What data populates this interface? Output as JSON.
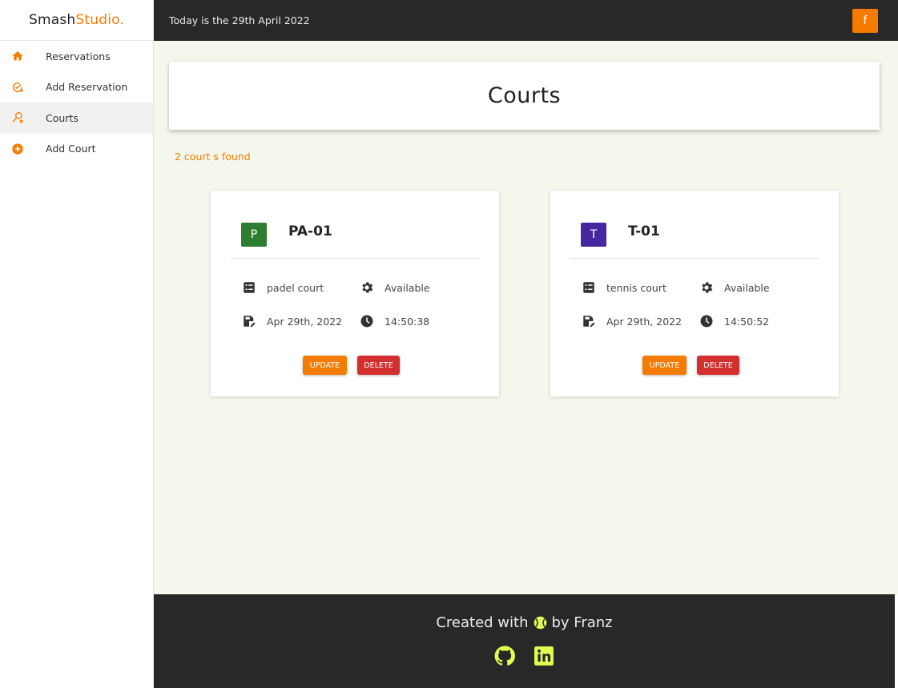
{
  "brand": {
    "part1": "Smash",
    "part2": "Studio."
  },
  "topbar": {
    "date_text": "Today is the 29th April 2022",
    "fb_label": "f"
  },
  "sidebar": {
    "items": [
      {
        "label": "Reservations",
        "icon": "home-icon"
      },
      {
        "label": "Add Reservation",
        "icon": "calendar-check-icon"
      },
      {
        "label": "Courts",
        "icon": "court-icon"
      },
      {
        "label": "Add Court",
        "icon": "add-circle-icon"
      }
    ]
  },
  "main": {
    "title": "Courts",
    "found_text": "2 court s found"
  },
  "courts": [
    {
      "initial": "P",
      "name": "PA-01",
      "description": "padel court",
      "status": "Available",
      "date": "Apr 29th, 2022",
      "time": "14:50:38",
      "avatar_color": "#2e7d32",
      "update_label": "UPDATE",
      "delete_label": "DELETE"
    },
    {
      "initial": "T",
      "name": "T-01",
      "description": "tennis court",
      "status": "Available",
      "date": "Apr 29th, 2022",
      "time": "14:50:52",
      "avatar_color": "#4527a0",
      "update_label": "UPDATE",
      "delete_label": "DELETE"
    }
  ],
  "footer": {
    "credit_before": "Created with",
    "credit_after": "by Franz"
  },
  "colors": {
    "accent": "#f57c00",
    "danger": "#d32f2f",
    "dark": "#282828",
    "main_bg": "#f3f7ec"
  }
}
